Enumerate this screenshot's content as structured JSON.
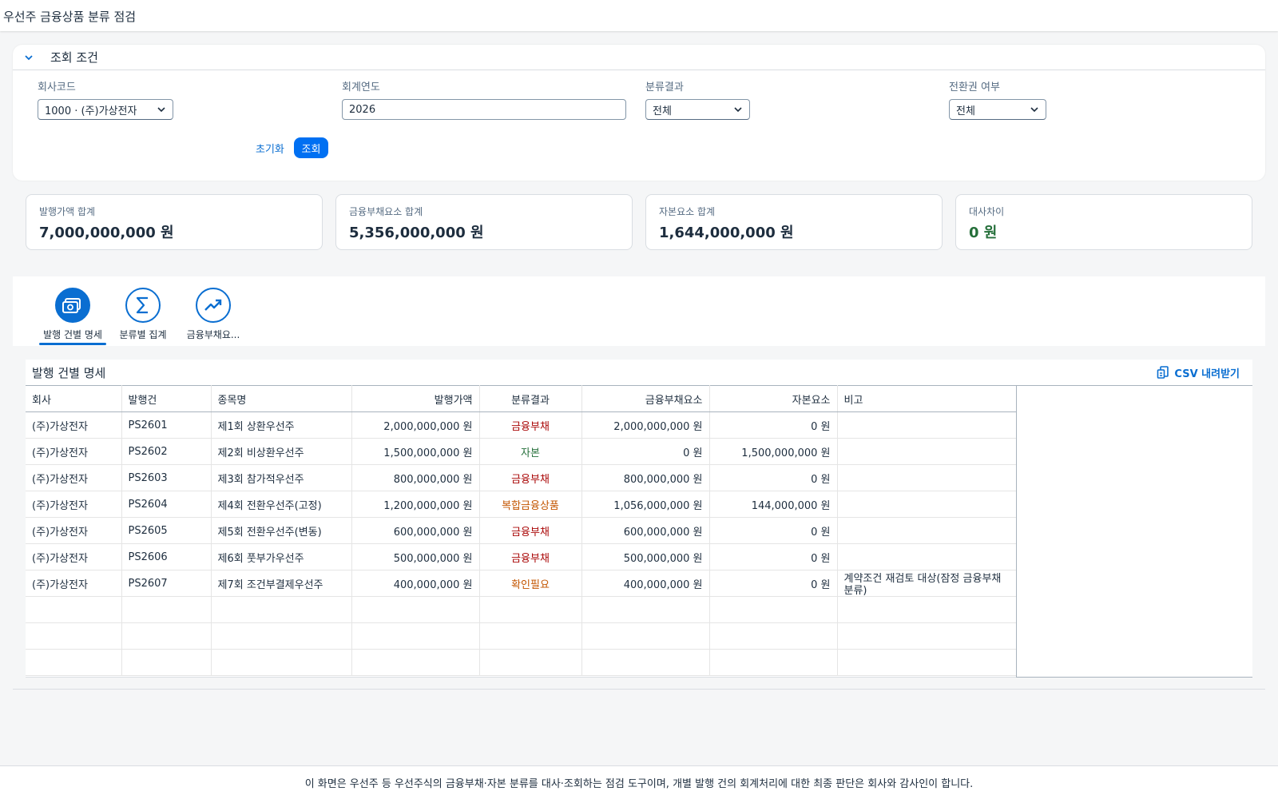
{
  "header": {
    "title": "우선주 금융상품 분류 점검"
  },
  "filter": {
    "title": "조회 조건",
    "company": {
      "label": "회사코드",
      "value": "1000 · (주)가상전자"
    },
    "year": {
      "label": "회계연도",
      "value": "2026"
    },
    "classification": {
      "label": "분류결과",
      "value": "전체"
    },
    "conversion": {
      "label": "전환권 여부",
      "value": "전체"
    },
    "reset_label": "초기화",
    "search_label": "조회"
  },
  "kpis": [
    {
      "label": "발행가액 합계",
      "value": "7,000,000,000 원"
    },
    {
      "label": "금융부채요소 합계",
      "value": "5,356,000,000 원"
    },
    {
      "label": "자본요소 합계",
      "value": "1,644,000,000 원"
    },
    {
      "label": "대사차이",
      "value": "0 원"
    }
  ],
  "tabs": [
    {
      "label": "발행 건별 명세",
      "icon": "money-icon"
    },
    {
      "label": "분류별 집계",
      "icon": "sigma-icon"
    },
    {
      "label": "금융부채요...",
      "icon": "trend-up-icon"
    }
  ],
  "table": {
    "title": "발행 건별 명세",
    "csv_label": "CSV 내려받기",
    "columns": [
      "회사",
      "발행건",
      "종목명",
      "발행가액",
      "분류결과",
      "금융부채요소",
      "자본요소",
      "비고"
    ],
    "rows": [
      {
        "company": "(주)가상전자",
        "id": "PS2601",
        "name": "제1회 상환우선주",
        "issue": "2,000,000,000 원",
        "class": "금융부채",
        "cls": "liab",
        "liability": "2,000,000,000 원",
        "equity": "0 원",
        "note": ""
      },
      {
        "company": "(주)가상전자",
        "id": "PS2602",
        "name": "제2회 비상환우선주",
        "issue": "1,500,000,000 원",
        "class": "자본",
        "cls": "eq",
        "liability": "0 원",
        "equity": "1,500,000,000 원",
        "note": ""
      },
      {
        "company": "(주)가상전자",
        "id": "PS2603",
        "name": "제3회 참가적우선주",
        "issue": "800,000,000 원",
        "class": "금융부채",
        "cls": "liab",
        "liability": "800,000,000 원",
        "equity": "0 원",
        "note": ""
      },
      {
        "company": "(주)가상전자",
        "id": "PS2604",
        "name": "제4회 전환우선주(고정)",
        "issue": "1,200,000,000 원",
        "class": "복합금융상품",
        "cls": "compound",
        "liability": "1,056,000,000 원",
        "equity": "144,000,000 원",
        "note": ""
      },
      {
        "company": "(주)가상전자",
        "id": "PS2605",
        "name": "제5회 전환우선주(변동)",
        "issue": "600,000,000 원",
        "class": "금융부채",
        "cls": "liab",
        "liability": "600,000,000 원",
        "equity": "0 원",
        "note": ""
      },
      {
        "company": "(주)가상전자",
        "id": "PS2606",
        "name": "제6회 풋부가우선주",
        "issue": "500,000,000 원",
        "class": "금융부채",
        "cls": "liab",
        "liability": "500,000,000 원",
        "equity": "0 원",
        "note": ""
      },
      {
        "company": "(주)가상전자",
        "id": "PS2607",
        "name": "제7회 조건부결제우선주",
        "issue": "400,000,000 원",
        "class": "확인필요",
        "cls": "check",
        "liability": "400,000,000 원",
        "equity": "0 원",
        "note": "계약조건 재검토 대상(잠정 금융부채 분류)"
      }
    ]
  },
  "footer": {
    "text": "이 화면은 우선주 등 우선주식의 금융부채·자본 분류를 대사·조회하는 점검 도구이며, 개별 발행 건의 회계처리에 대한 최종 판단은 회사와 감사인이 합니다."
  },
  "colors": {
    "accent": "#0a6ed1",
    "liability": "#aa0808",
    "equity": "#256f3a",
    "warning": "#c35500"
  }
}
